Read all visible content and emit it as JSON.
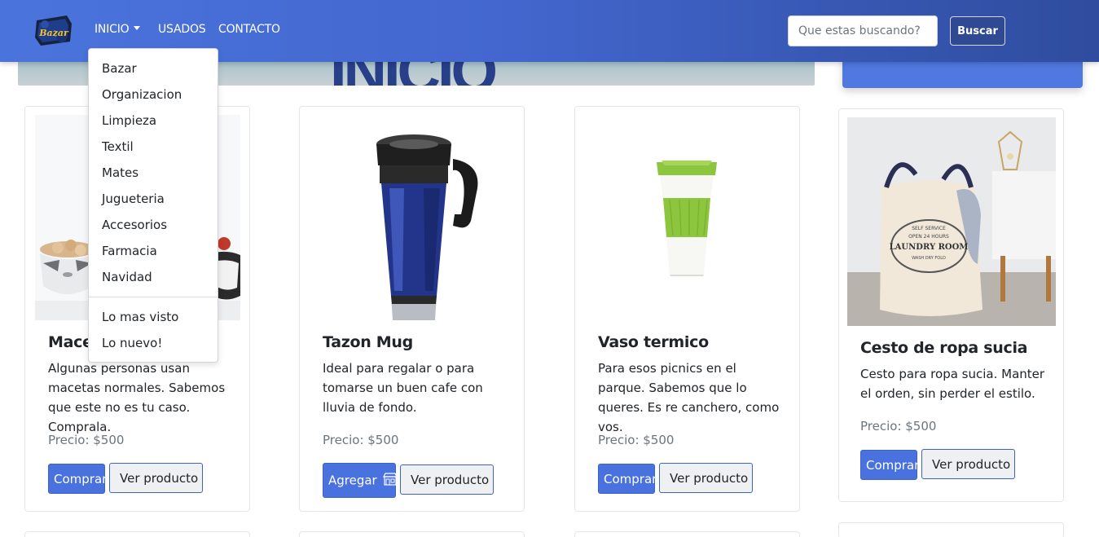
{
  "nav": {
    "logo_text": "Bazar",
    "links": [
      "INICIO",
      "USADOS",
      "CONTACTO"
    ],
    "search": {
      "placeholder": "Que estas buscando?",
      "button": "Buscar"
    }
  },
  "banner": {
    "title": "INICIO"
  },
  "dropdown": {
    "items": [
      "Bazar",
      "Organizacion",
      "Limpieza",
      "Textil",
      "Mates",
      "Jugueteria",
      "Accesorios",
      "Farmacia",
      "Navidad"
    ],
    "extra": [
      "Lo mas visto",
      "Lo nuevo!"
    ]
  },
  "products": [
    {
      "title": "Maceta",
      "description": "Algunas personas usan macetas normales. Sabemos que este no es tu caso. Comprala.",
      "price": "Precio: $500",
      "primary_label": "Comprar",
      "secondary_label": "Ver producto"
    },
    {
      "title": "Tazon Mug",
      "description": "Ideal para regalar o para tomarse un buen cafe con lluvia de fondo.",
      "price": "Precio: $500",
      "primary_label": "Agregar",
      "secondary_label": "Ver producto"
    },
    {
      "title": "Vaso termico",
      "description": "Para esos picnics en el parque. Sabemos que lo queres. Es re canchero, como vos.",
      "price": "Precio: $500",
      "primary_label": "Comprar",
      "secondary_label": "Ver producto"
    },
    {
      "title": "Cesto de ropa sucia",
      "description": "Cesto para ropa sucia. Manter el orden, sin perder el estilo.",
      "price": "Precio: $500",
      "primary_label": "Comprar",
      "secondary_label": "Ver producto"
    }
  ],
  "laundry_label": {
    "line1": "SELF SERVICE",
    "line2": "OPEN 24 HOURS",
    "line3": "LAUNDRY ROOM",
    "line4": "WASH DRY FOLD"
  },
  "colors": {
    "navbar": "#4367cf",
    "primary": "#4a72de",
    "accent_green": "#8cc63f"
  }
}
